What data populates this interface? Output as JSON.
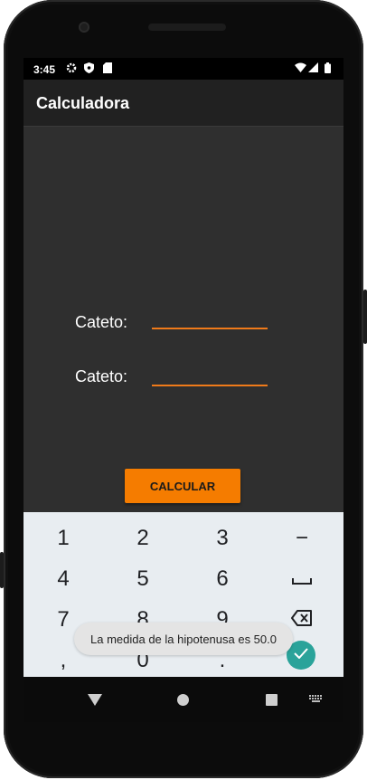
{
  "status_bar": {
    "time": "3:45",
    "icons": [
      "gear-icon",
      "shield-icon",
      "sd-card-icon",
      "wifi-icon",
      "signal-icon",
      "battery-icon"
    ]
  },
  "app_bar": {
    "title": "Calculadora"
  },
  "form": {
    "cateto1_label": "Cateto:",
    "cateto1_value": "",
    "cateto2_label": "Cateto:",
    "cateto2_value": "",
    "calculate_label": "CALCULAR"
  },
  "keyboard": {
    "row1": [
      "1",
      "2",
      "3",
      "−"
    ],
    "row2": [
      "4",
      "5",
      "6"
    ],
    "row3": [
      "7",
      "8",
      "9"
    ],
    "row4": [
      ",",
      "0",
      "."
    ]
  },
  "toast": {
    "message": "La medida de la hipotenusa es 50.0"
  },
  "navigation": {
    "icons": [
      "back-icon",
      "home-icon",
      "recents-icon",
      "keyboard-switch-icon"
    ]
  },
  "colors": {
    "accent": "#F57C00",
    "field_underline": "#EF7A1A",
    "screen_bg": "#2F2F2F",
    "appbar_bg": "#212121",
    "keyboard_bg": "#E8EDF1",
    "ok_key": "#2AA39A"
  }
}
